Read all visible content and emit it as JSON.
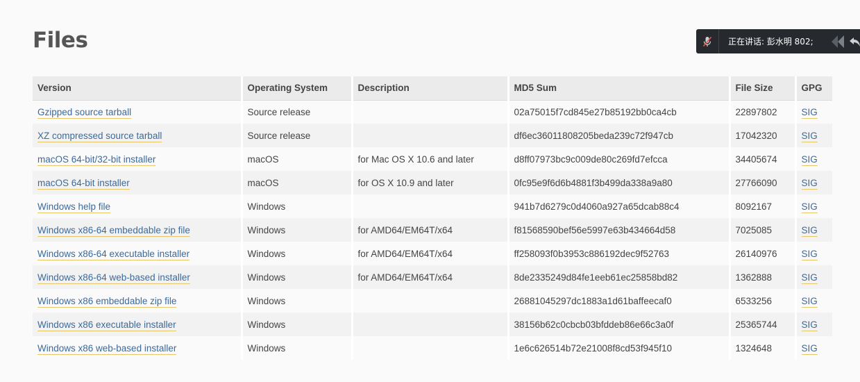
{
  "page": {
    "title": "Files"
  },
  "table": {
    "headers": [
      "Version",
      "Operating System",
      "Description",
      "MD5 Sum",
      "File Size",
      "GPG"
    ],
    "rows": [
      {
        "version": "Gzipped source tarball",
        "os": "Source release",
        "description": "",
        "md5": "02a75015f7cd845e27b85192bb0ca4cb",
        "size": "22897802",
        "gpg": "SIG"
      },
      {
        "version": "XZ compressed source tarball",
        "os": "Source release",
        "description": "",
        "md5": "df6ec36011808205beda239c72f947cb",
        "size": "17042320",
        "gpg": "SIG"
      },
      {
        "version": "macOS 64-bit/32-bit installer",
        "os": "macOS",
        "description": "for Mac OS X 10.6 and later",
        "md5": "d8ff07973bc9c009de80c269fd7efcca",
        "size": "34405674",
        "gpg": "SIG"
      },
      {
        "version": "macOS 64-bit installer",
        "os": "macOS",
        "description": "for OS X 10.9 and later",
        "md5": "0fc95e9f6d6b4881f3b499da338a9a80",
        "size": "27766090",
        "gpg": "SIG"
      },
      {
        "version": "Windows help file",
        "os": "Windows",
        "description": "",
        "md5": "941b7d6279c0d4060a927a65dcab88c4",
        "size": "8092167",
        "gpg": "SIG"
      },
      {
        "version": "Windows x86-64 embeddable zip file",
        "os": "Windows",
        "description": "for AMD64/EM64T/x64",
        "md5": "f81568590bef56e5997e63b434664d58",
        "size": "7025085",
        "gpg": "SIG"
      },
      {
        "version": "Windows x86-64 executable installer",
        "os": "Windows",
        "description": "for AMD64/EM64T/x64",
        "md5": "ff258093f0b3953c886192dec9f52763",
        "size": "26140976",
        "gpg": "SIG"
      },
      {
        "version": "Windows x86-64 web-based installer",
        "os": "Windows",
        "description": "for AMD64/EM64T/x64",
        "md5": "8de2335249d84fe1eeb61ec25858bd82",
        "size": "1362888",
        "gpg": "SIG"
      },
      {
        "version": "Windows x86 embeddable zip file",
        "os": "Windows",
        "description": "",
        "md5": "26881045297dc1883a1d61baffeecaf0",
        "size": "6533256",
        "gpg": "SIG"
      },
      {
        "version": "Windows x86 executable installer",
        "os": "Windows",
        "description": "",
        "md5": "38156b62c0cbcb03bfddeb86e66c3a0f",
        "size": "25365744",
        "gpg": "SIG"
      },
      {
        "version": "Windows x86 web-based installer",
        "os": "Windows",
        "description": "",
        "md5": "1e6c626514b72e21008f8cd53f945f10",
        "size": "1324648",
        "gpg": "SIG"
      }
    ]
  },
  "overlay": {
    "speaking_text": "正在讲话: 彭水明 802;",
    "icons": [
      "mic-muted-icon",
      "collapse-arrows-icon",
      "undo-arrow-icon"
    ]
  },
  "colors": {
    "link": "#3a6a9d",
    "link_underline": "#e8c76b",
    "header_bg": "#ebebeb",
    "overlay_bg": "#262a2e",
    "mic_muted": "#e05a4e"
  }
}
